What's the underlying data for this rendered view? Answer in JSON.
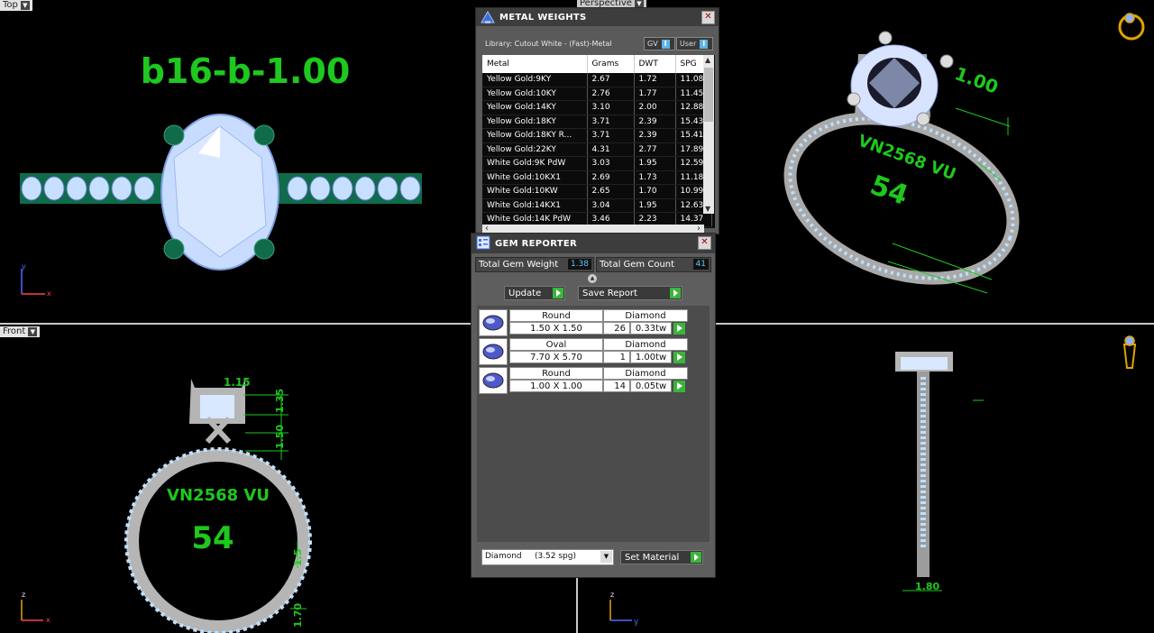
{
  "viewports": {
    "top": {
      "label": "Top"
    },
    "perspective": {
      "label": "Perspective"
    },
    "front": {
      "label": "Front"
    },
    "title_text": "b16-b-1.00",
    "ring_inscription": "VN2568 VU",
    "ring_size": "54",
    "persp_dim": "1.00",
    "front_dims": [
      "1.15",
      "1.35",
      "1.50",
      "1.5",
      "1.70"
    ],
    "side_dim": "1.80"
  },
  "metal_weights": {
    "title": "METAL WEIGHTS",
    "library": "Library: Cutout White - (Fast)-Metal",
    "toggle_gv": "GV",
    "toggle_user": "User",
    "toggle_icon": "I",
    "columns": [
      "Metal",
      "Grams",
      "DWT",
      "SPG"
    ],
    "rows": [
      [
        "Yellow Gold:9KY",
        "2.67",
        "1.72",
        "11.08"
      ],
      [
        "Yellow Gold:10KY",
        "2.76",
        "1.77",
        "11.45"
      ],
      [
        "Yellow Gold:14KY",
        "3.10",
        "2.00",
        "12.88"
      ],
      [
        "Yellow Gold:18KY",
        "3.71",
        "2.39",
        "15.43"
      ],
      [
        "Yellow Gold:18KY R...",
        "3.71",
        "2.39",
        "15.41"
      ],
      [
        "Yellow Gold:22KY",
        "4.31",
        "2.77",
        "17.89"
      ],
      [
        "White Gold:9K PdW",
        "3.03",
        "1.95",
        "12.59"
      ],
      [
        "White Gold:10KX1",
        "2.69",
        "1.73",
        "11.18"
      ],
      [
        "White Gold:10KW",
        "2.65",
        "1.70",
        "10.99"
      ],
      [
        "White Gold:14KX1",
        "3.04",
        "1.95",
        "12.63"
      ],
      [
        "White Gold:14K PdW",
        "3.46",
        "2.23",
        "14.37"
      ]
    ]
  },
  "gem_reporter": {
    "title": "GEM REPORTER",
    "total_weight_label": "Total Gem Weight",
    "total_weight_value": "1.38",
    "total_count_label": "Total Gem Count",
    "total_count_value": "41",
    "update_label": "Update",
    "save_report_label": "Save Report",
    "gems": [
      {
        "shape": "Round",
        "material": "Diamond",
        "size": "1.50 X 1.50",
        "count": "26",
        "weight": "0.33tw"
      },
      {
        "shape": "Oval",
        "material": "Diamond",
        "size": "7.70 X 5.70",
        "count": "1",
        "weight": "1.00tw"
      },
      {
        "shape": "Round",
        "material": "Diamond",
        "size": "1.00 X 1.00",
        "count": "14",
        "weight": "0.05tw"
      }
    ],
    "material_select": "Diamond     (3.52 spg)",
    "set_material_label": "Set Material"
  },
  "colors": {
    "accent_green": "#1ec81e",
    "gem_blue": "#c8e0ff",
    "prong_green": "#0f6b4a",
    "value_blue": "#5fc7ff"
  }
}
